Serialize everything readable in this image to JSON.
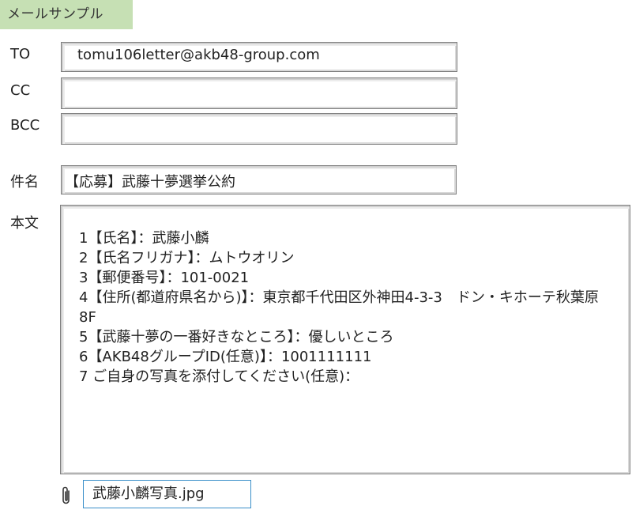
{
  "window": {
    "title": "メールサンプル"
  },
  "form": {
    "to": {
      "label": "TO",
      "value": "tomu106letter@akb48-group.com"
    },
    "cc": {
      "label": "CC",
      "value": ""
    },
    "bcc": {
      "label": "BCC",
      "value": ""
    },
    "subject": {
      "label": "件名",
      "value": "【応募】武藤十夢選挙公約"
    },
    "body": {
      "label": "本文",
      "lines": [
        "1【氏名】：武藤小麟",
        "2【氏名フリガナ】：ムトウオリン",
        "3【郵便番号】：101-0021",
        "4【住所(都道府県名から)】：東京都千代田区外神田4-3-3　ドン・キホーテ秋葉原8F",
        "5【武藤十夢の一番好きなところ】：優しいところ",
        "6【AKB48グループID(任意)】：1001111111",
        "7 ご自身の写真を添付してください(任意)："
      ]
    },
    "attachment": {
      "icon": "paperclip-icon",
      "filename": "武藤小麟写真.jpg"
    }
  },
  "colors": {
    "title_badge_bg": "#c6e0b4",
    "attachment_border": "#3a8fc9"
  }
}
